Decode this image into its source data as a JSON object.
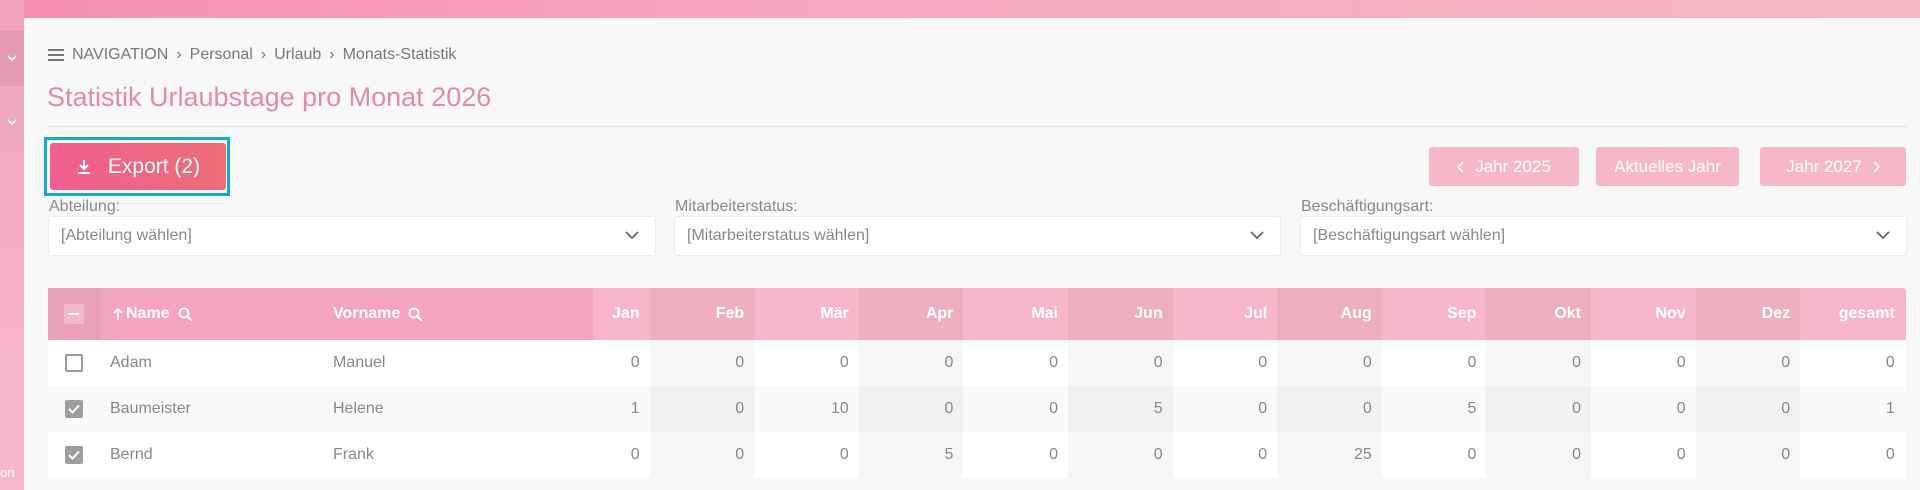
{
  "sidebar": {
    "fragment": "on"
  },
  "breadcrumb": {
    "items": [
      "NAVIGATION",
      "Personal",
      "Urlaub",
      "Monats-Statistik"
    ]
  },
  "page": {
    "title": "Statistik Urlaubstage pro Monat 2026"
  },
  "toolbar": {
    "export_label": "Export (2)",
    "prev_year": "Jahr 2025",
    "current_year": "Aktuelles Jahr",
    "next_year": "Jahr 2027"
  },
  "filters": [
    {
      "label": "Abteilung:",
      "placeholder": "[Abteilung wählen]"
    },
    {
      "label": "Mitarbeiterstatus:",
      "placeholder": "[Mitarbeiterstatus wählen]"
    },
    {
      "label": "Beschäftigungsart:",
      "placeholder": "[Beschäftigungsart wählen]"
    }
  ],
  "table": {
    "headers": {
      "name": "Name",
      "vorname": "Vorname",
      "months": [
        "Jan",
        "Feb",
        "Mär",
        "Apr",
        "Mai",
        "Jun",
        "Jul",
        "Aug",
        "Sep",
        "Okt",
        "Nov",
        "Dez",
        "gesamt"
      ]
    },
    "rows": [
      {
        "checked": false,
        "name": "Adam",
        "vorname": "Manuel",
        "values": [
          "0",
          "0",
          "0",
          "0",
          "0",
          "0",
          "0",
          "0",
          "0",
          "0",
          "0",
          "0",
          "0"
        ]
      },
      {
        "checked": true,
        "name": "Baumeister",
        "vorname": "Helene",
        "values": [
          "1",
          "0",
          "10",
          "0",
          "0",
          "5",
          "0",
          "0",
          "5",
          "0",
          "0",
          "0",
          "1"
        ]
      },
      {
        "checked": true,
        "name": "Bernd",
        "vorname": "Frank",
        "values": [
          "0",
          "0",
          "0",
          "5",
          "0",
          "0",
          "0",
          "25",
          "0",
          "0",
          "0",
          "0",
          "0"
        ]
      }
    ]
  },
  "colors": {
    "accent": "#ef5f8f",
    "header": "#f6b5c8",
    "focus": "#14a6e0"
  }
}
